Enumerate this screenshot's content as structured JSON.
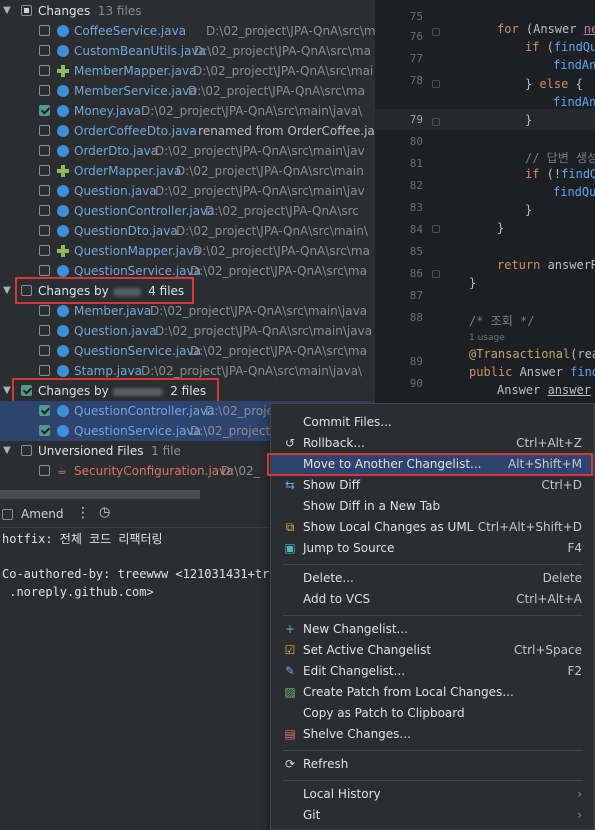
{
  "tree": {
    "changes_group": {
      "label": "Changes",
      "count": "13 files"
    },
    "changes_files": [
      {
        "name": "CoffeeService.java",
        "path": "D:\\02_project\\JPA-QnA\\src\\main",
        "checked": false,
        "icon": "java-class-icon",
        "status": "modified"
      },
      {
        "name": "CustomBeanUtils.java",
        "path": "D:\\02_project\\JPA-QnA\\src\\ma",
        "checked": false,
        "icon": "java-class-icon",
        "status": "modified"
      },
      {
        "name": "MemberMapper.java",
        "path": "D:\\02_project\\JPA-QnA\\src\\mai",
        "checked": false,
        "icon": "mapper-icon",
        "status": "modified"
      },
      {
        "name": "MemberService.java",
        "path": "D:\\02_project\\JPA-QnA\\src\\ma",
        "checked": false,
        "icon": "java-class-icon",
        "status": "modified"
      },
      {
        "name": "Money.java",
        "path": "D:\\02_project\\JPA-QnA\\src\\main\\java\\",
        "checked": true,
        "icon": "java-class-icon",
        "status": "modified"
      },
      {
        "name": "OrderCoffeeDto.java",
        "path": "- renamed from OrderCoffee.java",
        "checked": false,
        "icon": "java-class-icon",
        "status": "modified"
      },
      {
        "name": "OrderDto.java",
        "path": "D:\\02_project\\JPA-QnA\\src\\main\\jav",
        "checked": false,
        "icon": "java-class-icon",
        "status": "modified"
      },
      {
        "name": "OrderMapper.java",
        "path": "D:\\02_project\\JPA-QnA\\src\\main",
        "checked": false,
        "icon": "mapper-icon",
        "status": "modified"
      },
      {
        "name": "Question.java",
        "path": "D:\\02_project\\JPA-QnA\\src\\main\\jav",
        "checked": false,
        "icon": "java-class-icon",
        "status": "modified"
      },
      {
        "name": "QuestionController.java",
        "path": "D:\\02_project\\JPA-QnA\\src",
        "checked": false,
        "icon": "java-class-icon",
        "status": "modified"
      },
      {
        "name": "QuestionDto.java",
        "path": "D:\\02_project\\JPA-QnA\\src\\main\\",
        "checked": false,
        "icon": "java-class-icon",
        "status": "modified"
      },
      {
        "name": "QuestionMapper.java",
        "path": "D:\\02_project\\JPA-QnA\\src\\ma",
        "checked": false,
        "icon": "mapper-icon",
        "status": "modified"
      },
      {
        "name": "QuestionService.java",
        "path": "D:\\02_project\\JPA-QnA\\src\\ma",
        "checked": false,
        "icon": "java-class-icon",
        "status": "modified"
      }
    ],
    "group2": {
      "label": "Changes by",
      "count": "4 files"
    },
    "group2_files": [
      {
        "name": "Member.java",
        "path": "D:\\02_project\\JPA-QnA\\src\\main\\java"
      },
      {
        "name": "Question.java",
        "path": "D:\\02_project\\JPA-QnA\\src\\main\\java"
      },
      {
        "name": "QuestionService.java",
        "path": "D:\\02_project\\JPA-QnA\\src\\ma"
      },
      {
        "name": "Stamp.java",
        "path": "D:\\02_project\\JPA-QnA\\src\\main\\java\\"
      }
    ],
    "group3": {
      "label": "Changes by",
      "count": "2 files"
    },
    "group3_files": [
      {
        "name": "QuestionController.java",
        "path": "D:\\02_project"
      },
      {
        "name": "QuestionService.java",
        "path": "D:\\02_project\\"
      }
    ],
    "unversioned": {
      "label": "Unversioned Files",
      "count": "1 file"
    },
    "unversioned_files": [
      {
        "name": "SecurityConfiguration.java",
        "path": "D:\\02_"
      }
    ]
  },
  "editor": {
    "line_numbers": [
      "75",
      "76",
      "77",
      "78",
      "79",
      "80",
      "81",
      "82",
      "83",
      "84",
      "85",
      "86",
      "87",
      "88",
      "89",
      "90",
      "91",
      "92",
      "93"
    ],
    "current_line": "79",
    "usage_hint": "1 usage"
  },
  "commit": {
    "amend_label": "Amend",
    "more_icon": "more-vertical-icon",
    "history_icon": "clock-icon",
    "message_lines": [
      "hotfix: 전체 코드 리팩터링",
      "",
      "Co-authored-by: treewww <121031431+tree",
      " .noreply.github.com>"
    ]
  },
  "menu": {
    "items": [
      {
        "label": "Commit Files...",
        "shortcut": "",
        "icon": ""
      },
      {
        "label": "Rollback...",
        "shortcut": "Ctrl+Alt+Z",
        "icon": "rollback-icon"
      },
      {
        "label": "Move to Another Changelist...",
        "shortcut": "Alt+Shift+M",
        "icon": ""
      },
      {
        "label": "Show Diff",
        "shortcut": "Ctrl+D",
        "icon": "diff-icon"
      },
      {
        "label": "Show Diff in a New Tab",
        "shortcut": "",
        "icon": ""
      },
      {
        "label": "Show Local Changes as UML",
        "shortcut": "Ctrl+Alt+Shift+D",
        "icon": "uml-icon"
      },
      {
        "label": "Jump to Source",
        "shortcut": "F4",
        "icon": "jump-source-icon"
      },
      {
        "label": "Delete...",
        "shortcut": "Delete",
        "icon": ""
      },
      {
        "label": "Add to VCS",
        "shortcut": "Ctrl+Alt+A",
        "icon": ""
      },
      {
        "label": "New Changelist...",
        "shortcut": "",
        "icon": "plus-icon"
      },
      {
        "label": "Set Active Changelist",
        "shortcut": "Ctrl+Space",
        "icon": "checkbox-icon"
      },
      {
        "label": "Edit Changelist...",
        "shortcut": "F2",
        "icon": "pencil-icon"
      },
      {
        "label": "Create Patch from Local Changes...",
        "shortcut": "",
        "icon": "patch-icon"
      },
      {
        "label": "Copy as Patch to Clipboard",
        "shortcut": "",
        "icon": ""
      },
      {
        "label": "Shelve Changes...",
        "shortcut": "",
        "icon": "shelve-icon"
      },
      {
        "label": "Refresh",
        "shortcut": "",
        "icon": "refresh-icon"
      },
      {
        "label": "Local History",
        "shortcut": "",
        "icon": ""
      },
      {
        "label": "Git",
        "shortcut": "",
        "icon": ""
      }
    ]
  },
  "colors": {
    "highlight_box": "#d3393b",
    "selection": "#2e436e",
    "modified_file": "#6fa8dc",
    "added_file": "#6fb56d",
    "unversioned_file": "#d9756a"
  }
}
